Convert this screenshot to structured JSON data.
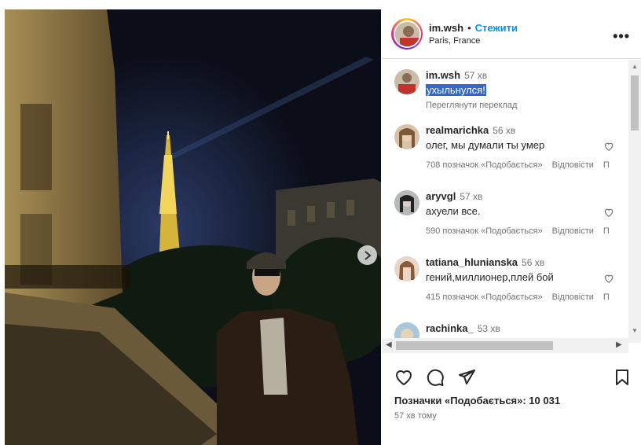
{
  "header": {
    "username": "im.wsh",
    "separator": "•",
    "follow_label": "Стежити",
    "location": "Paris, France",
    "more_label": "•••"
  },
  "caption": {
    "username": "im.wsh",
    "time": "57 хв",
    "text": "ухыльнулся!",
    "translate_label": "Переглянути переклад"
  },
  "comments": [
    {
      "username": "realmarichka",
      "time": "56 хв",
      "text": "олег, мы думали ты умер",
      "likes": "708 позначок «Подобається»",
      "reply": "Відповісти",
      "extra": "П"
    },
    {
      "username": "aryvgl",
      "time": "57 хв",
      "text": "ахуели все.",
      "likes": "590 позначок «Подобається»",
      "reply": "Відповісти",
      "extra": "П"
    },
    {
      "username": "tatiana_hlunianska",
      "time": "56 хв",
      "text": "гений,миллионер,плей бой",
      "likes": "415 позначок «Подобається»",
      "reply": "Відповісти",
      "extra": "П"
    },
    {
      "username": "rachinka_",
      "time": "53 хв"
    }
  ],
  "footer": {
    "likes_text": "Позначки «Подобається»: 10 031",
    "time_ago": "57 хв тому"
  },
  "colors": {
    "follow": "#0095f6",
    "selection": "#3467c7",
    "muted": "#737373"
  }
}
